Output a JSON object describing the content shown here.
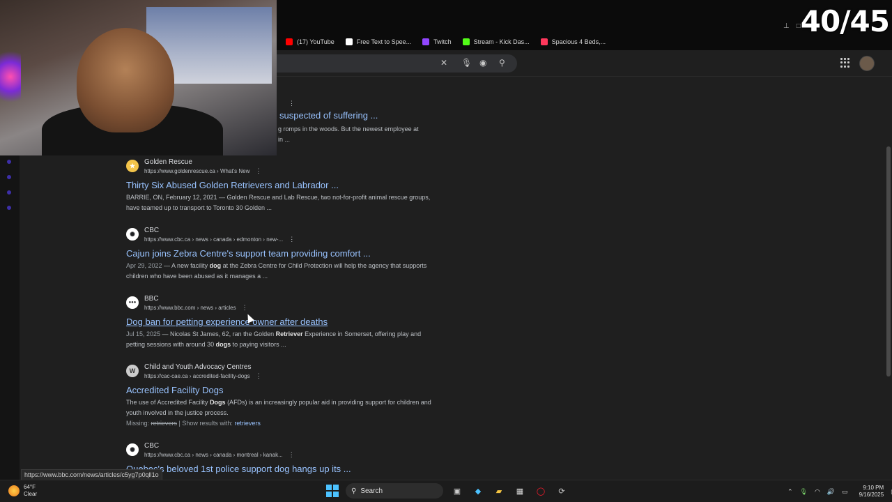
{
  "counter": "40/45",
  "bookmarks": [
    {
      "label": "(17) YouTube",
      "color": "#ff0000"
    },
    {
      "label": "Free Text to Spee...",
      "color": "#ffffff"
    },
    {
      "label": "Twitch",
      "color": "#9146ff"
    },
    {
      "label": "Stream - Kick Das...",
      "color": "#53fc18"
    },
    {
      "label": "Spacious 4 Beds,...",
      "color": "#ff385c"
    }
  ],
  "partial_result": {
    "title": "suspected of suffering ...",
    "snippet_line1": "g romps in the woods. But the newest employee at",
    "snippet_line2": "in ..."
  },
  "results": [
    {
      "site": "Golden Rescue",
      "url": "https://www.goldenrescue.ca › What's New",
      "favicon": "GR",
      "title": "Thirty Six Abused Golden Retrievers and Labrador ...",
      "date": "",
      "snippet_html": "BARRIE, ON, February 12, 2021 — Golden Rescue and Lab Rescue, two not-for-profit animal rescue groups, have teamed up to transport to Toronto 30 Golden ..."
    },
    {
      "site": "CBC",
      "url": "https://www.cbc.ca › news › canada › edmonton › new-...",
      "favicon": "✺",
      "title": "Cajun joins Zebra Centre's support team providing comfort ...",
      "date": "Apr 29, 2022",
      "snippet_pre": " — A new facility ",
      "snippet_bold": "dog",
      "snippet_post": " at the Zebra Centre for Child Protection will help the agency that supports children who have been abused as it manages a ..."
    },
    {
      "site": "BBC",
      "url": "https://www.bbc.com › news › articles",
      "favicon": "BBC",
      "title": "Dog ban for petting experience owner after deaths",
      "date": "Jul 15, 2025",
      "snippet_pre": " — Nicolas St James, 62, ran the Golden ",
      "snippet_bold": "Retriever",
      "snippet_post": " Experience in Somerset, offering play and petting sessions with around 30 ",
      "snippet_bold2": "dogs",
      "snippet_post2": " to paying visitors ..."
    },
    {
      "site": "Child and Youth Advocacy Centres",
      "url": "https://cac-cae.ca › accredited-facility-dogs",
      "favicon": "W",
      "title": "Accredited Facility Dogs",
      "snippet_pre": "The use of Accredited Facility ",
      "snippet_bold": "Dogs",
      "snippet_post": " (AFDs) is an increasingly popular aid in providing support for children and youth involved in the justice process.",
      "missing_label": "Missing: ",
      "missing_word": "retrievers",
      "missing_sep": " | Show results with: ",
      "missing_link": "retrievers"
    },
    {
      "site": "CBC",
      "url": "https://www.cbc.ca › news › canada › montreal › kanak...",
      "favicon": "✺",
      "title": "Quebec's beloved 1st police support dog hangs up its ..."
    }
  ],
  "status_url": "https://www.bbc.com/news/articles/c5yg7p0qll1o",
  "taskbar": {
    "temp": "64°F",
    "condition": "Clear",
    "search_label": "Search",
    "time": "9:10 PM",
    "date": "9/16/2025"
  }
}
